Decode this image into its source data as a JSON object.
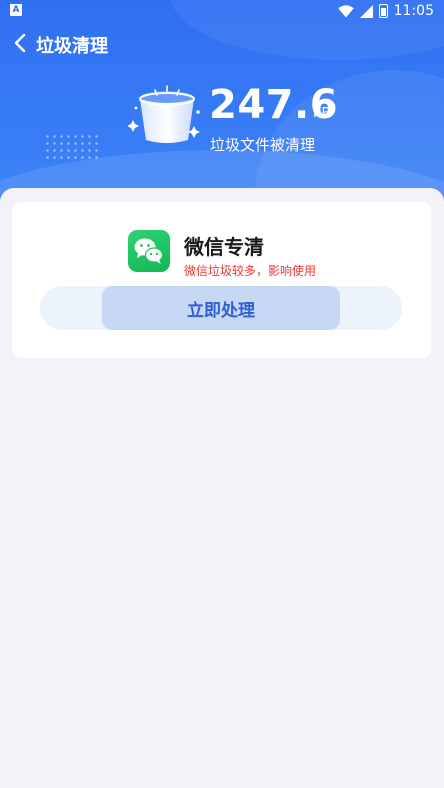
{
  "status_bar": {
    "carrier_badge": "A",
    "time": "11:05",
    "icons": [
      "wifi-icon",
      "cell-signal-icon",
      "battery-icon"
    ]
  },
  "header": {
    "title": "垃圾清理",
    "back_icon": "back-arrow-icon",
    "cleaned_size_value": "247.6",
    "cleaned_size_unit": "KB",
    "cleaned_label": "垃圾文件被清理",
    "illustration": "trash-bucket-icon"
  },
  "card": {
    "app_icon": "wechat-icon",
    "app_name": "微信专清",
    "warning": "微信垃圾较多，影响使用",
    "action_label": "立即处理"
  },
  "colors": {
    "header_blue": "#2f6ff2",
    "warning_red": "#e53935",
    "button_text": "#2f5fd0",
    "wechat_green": "#1fc25e"
  }
}
